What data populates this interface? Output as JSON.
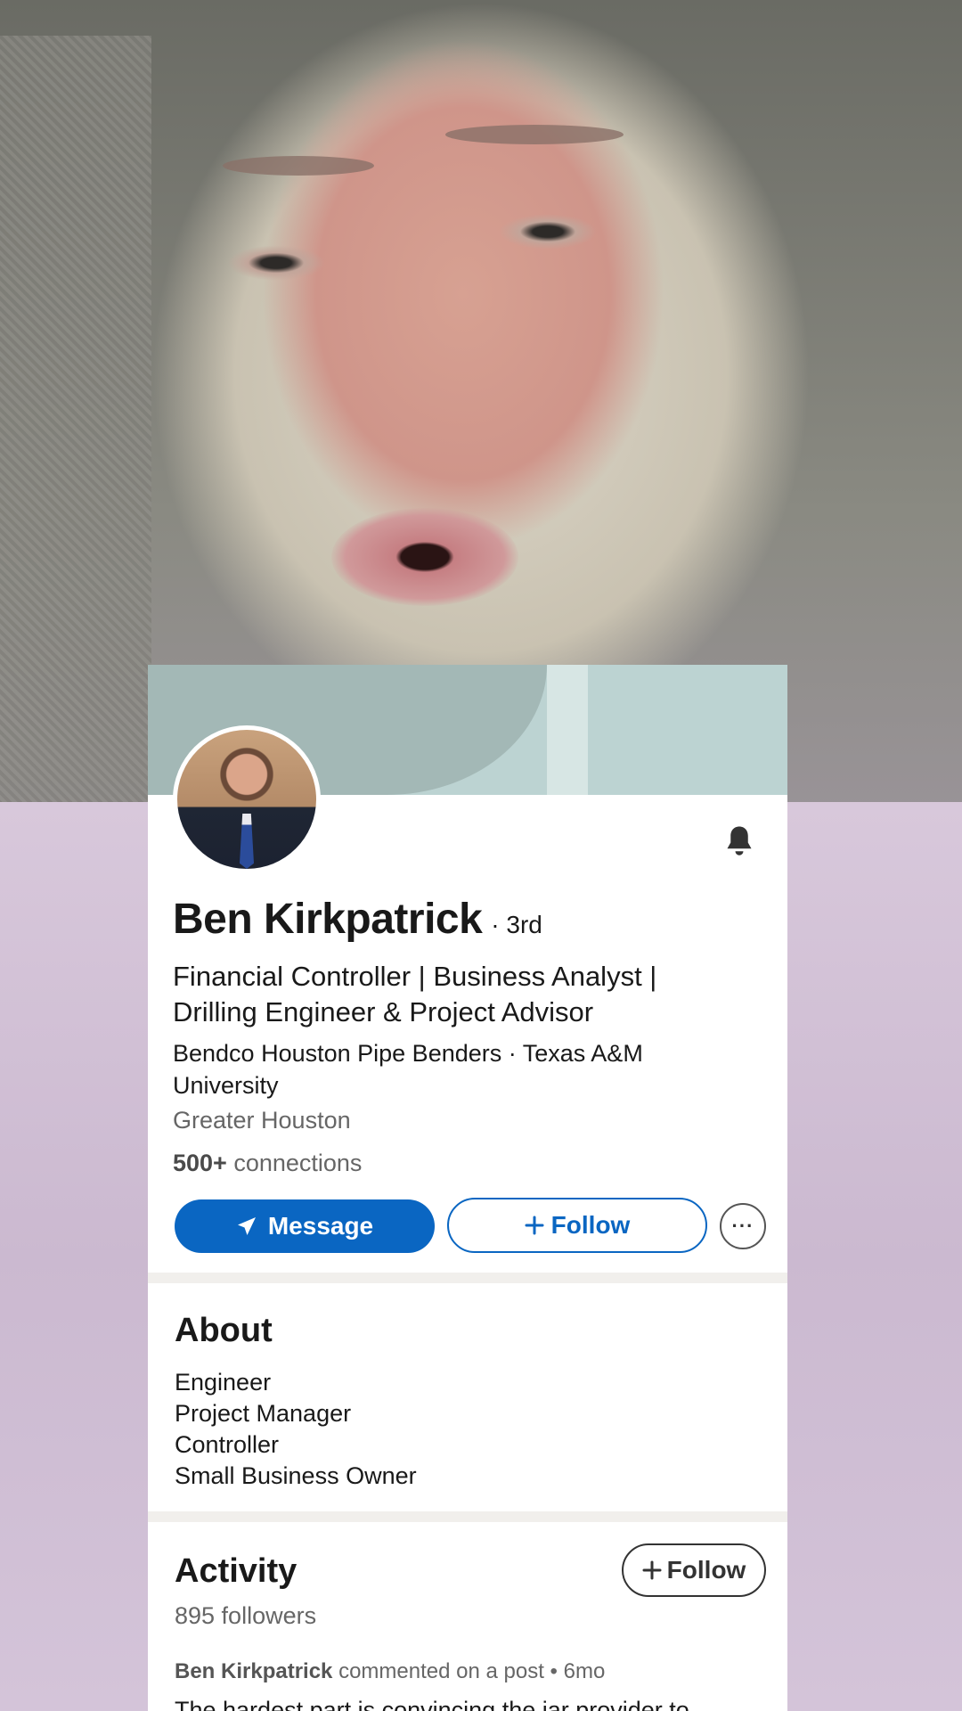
{
  "profile": {
    "name": "Ben Kirkpatrick",
    "degree": "· 3rd",
    "headline": "Financial Controller | Business Analyst | Drilling Engineer & Project Advisor",
    "company_line": "Bendco Houston Pipe Benders · Texas A&M University",
    "location": "Greater Houston",
    "connections_count": "500+",
    "connections_label": " connections"
  },
  "actions": {
    "message_label": "Message",
    "follow_label": "Follow",
    "more_label": "···"
  },
  "about": {
    "title": "About",
    "lines": [
      "Engineer",
      "Project Manager",
      "Controller",
      "Small Business Owner"
    ]
  },
  "activity": {
    "title": "Activity",
    "followers": "895 followers",
    "follow_label": "Follow",
    "meta_author": "Ben Kirkpatrick",
    "meta_action": " commented on a post",
    "meta_time": " • 6mo",
    "snippet": "The hardest part is convincing the jar provider to"
  },
  "colors": {
    "accent": "#0a66c2",
    "banner": "#bcd3d2"
  },
  "icons": {
    "message": "send-icon",
    "follow": "plus-icon",
    "notify": "bell-icon",
    "more": "ellipsis-icon"
  }
}
